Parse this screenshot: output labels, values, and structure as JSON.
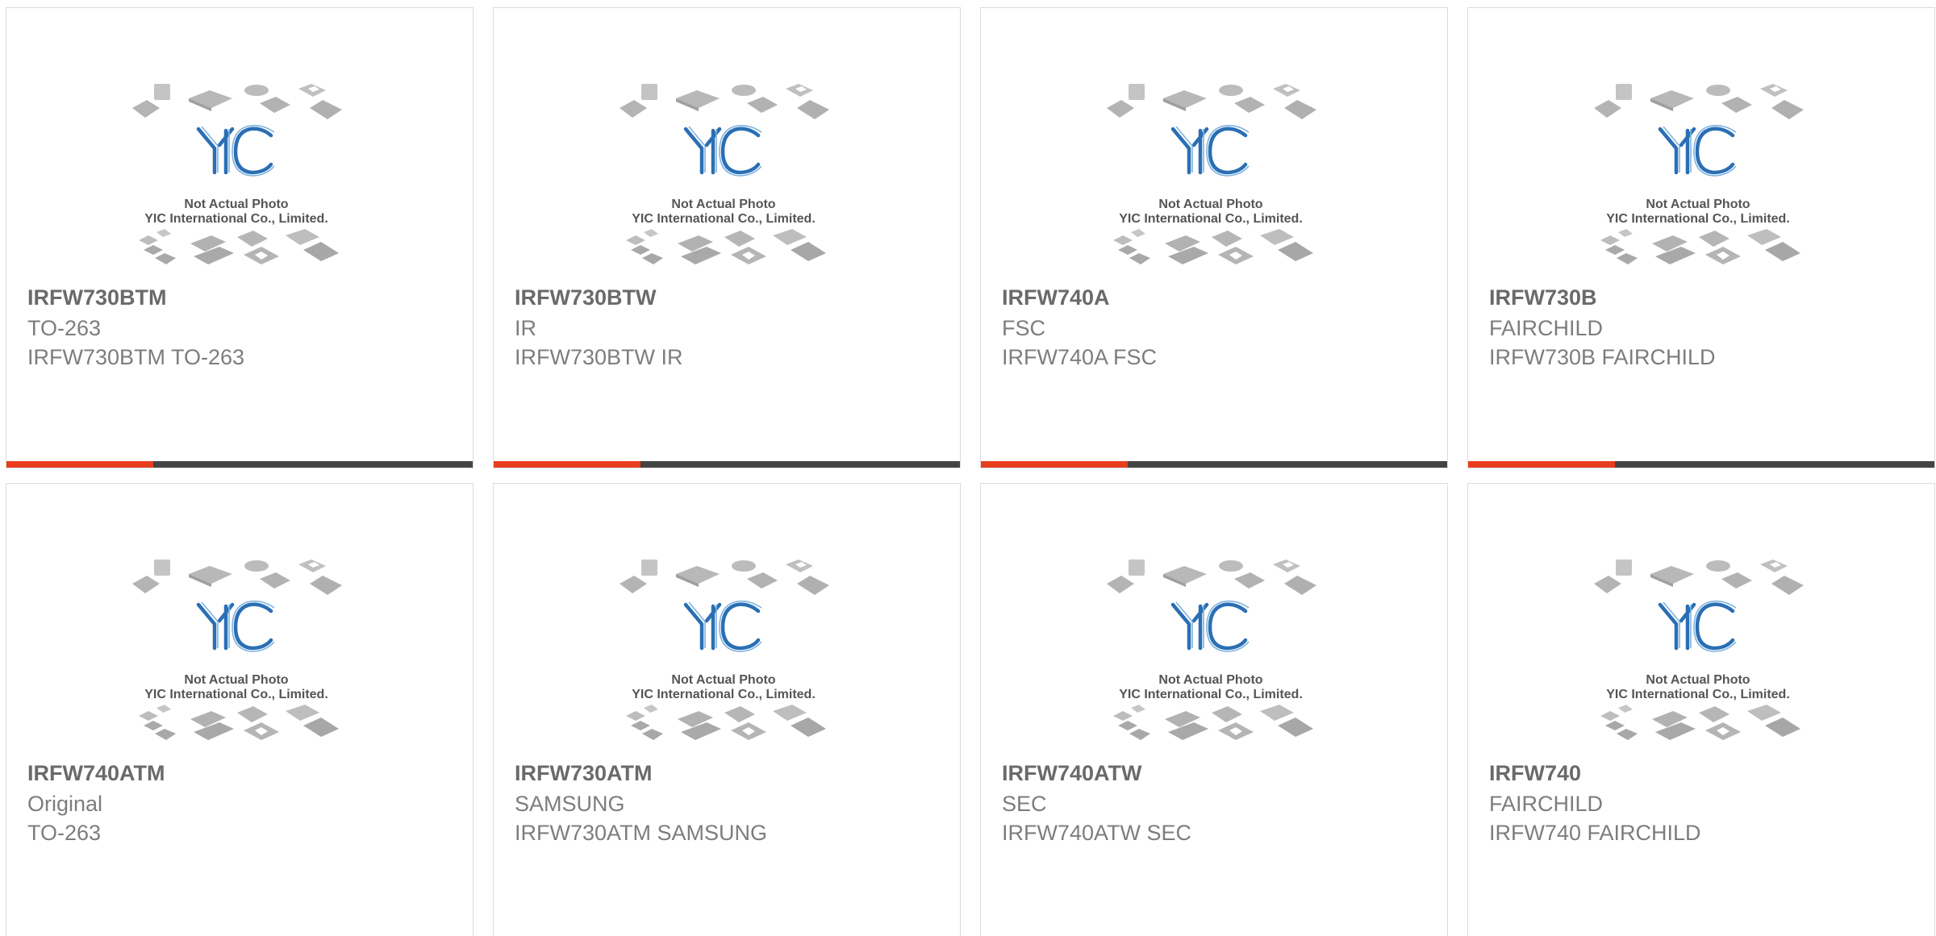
{
  "accent_color": "#e83e1e",
  "bar_color": "#444444",
  "thumbnail": {
    "note_line1": "Not Actual Photo",
    "note_line2": "YIC International Co., Limited.",
    "logo": "YIC"
  },
  "products": [
    {
      "part": "IRFW730BTM",
      "line1": "TO-263",
      "line2": "IRFW730BTM TO-263"
    },
    {
      "part": "IRFW730BTW",
      "line1": "IR",
      "line2": "IRFW730BTW IR"
    },
    {
      "part": "IRFW740A",
      "line1": "FSC",
      "line2": "IRFW740A FSC"
    },
    {
      "part": "IRFW730B",
      "line1": "FAIRCHILD",
      "line2": "IRFW730B FAIRCHILD"
    },
    {
      "part": "IRFW740ATM",
      "line1": "Original",
      "line2": "TO-263"
    },
    {
      "part": "IRFW730ATM",
      "line1": "SAMSUNG",
      "line2": "IRFW730ATM SAMSUNG"
    },
    {
      "part": "IRFW740ATW",
      "line1": "SEC",
      "line2": "IRFW740ATW SEC"
    },
    {
      "part": "IRFW740",
      "line1": "FAIRCHILD",
      "line2": "IRFW740 FAIRCHILD"
    }
  ]
}
